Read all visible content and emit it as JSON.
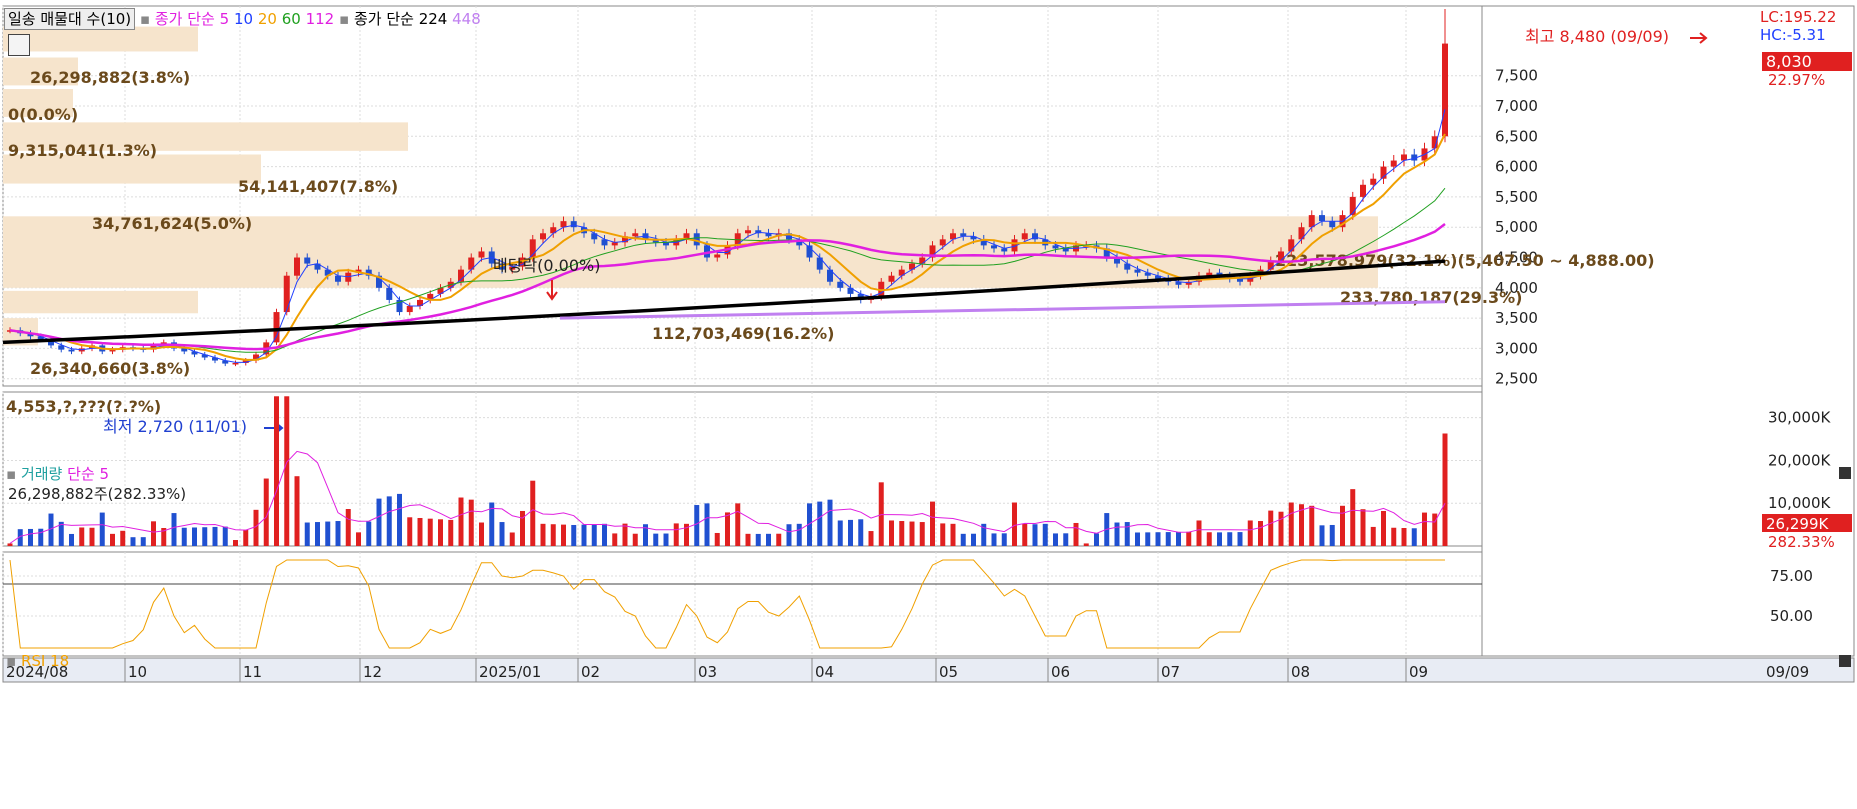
{
  "header": {
    "profile_label": "일송 매물대 수(10)",
    "ma_label": "종가 단순",
    "ma_periods": [
      "5",
      "10",
      "20",
      "60",
      "112"
    ],
    "ma_colors": [
      "#e020e0",
      "#2040ff",
      "#f0a000",
      "#20a020",
      "#e020e0"
    ],
    "long_label": "종가 단순",
    "long_periods": [
      "224",
      "448"
    ],
    "long_colors": [
      "#000000",
      "#c080f0"
    ],
    "lc": "LC:195.22",
    "hc": "HC:-5.31"
  },
  "price_panel": {
    "high_note": "최고 8,480 (09/09)",
    "low_note": "최저 2,720 (11/01)",
    "current_price": "8,030",
    "change_pct": "22.97%",
    "dividend_note": "배당락(0.00%)",
    "yticks": [
      "7,500",
      "7,000",
      "6,500",
      "6,000",
      "5,500",
      "5,000",
      "4,500",
      "4,000",
      "3,500",
      "3,000",
      "2,500"
    ],
    "profile_labels": [
      "26,298,882(3.8%)",
      "0(0.0%)",
      "9,315,041(1.3%)",
      "54,141,407(7.8%)",
      "34,761,624(5.0%)",
      "223,578,979(32.1%)(5,407.50 ~ 4,888.00)",
      "112,703,469(16.2%)",
      "233,780,187(29.3%)",
      "26,340,660(3.8%)",
      "4,553,?,???(?.?%)"
    ]
  },
  "volume_panel": {
    "title_a": "거래량",
    "title_b": "단순 5",
    "info": "26,298,882주(282.33%)",
    "current": "26,299K",
    "pct": "282.33%",
    "yticks": [
      "30,000K",
      "20,000K",
      "10,000K"
    ]
  },
  "rsi_panel": {
    "title": "RSI 18",
    "yticks": [
      "75.00",
      "50.00"
    ]
  },
  "xaxis": {
    "labels": [
      "2024/08",
      "10",
      "11",
      "12",
      "2025/01",
      "02",
      "03",
      "04",
      "05",
      "06",
      "07",
      "08",
      "09"
    ],
    "last_date": "09/09"
  },
  "chart_data": {
    "type": "candlestick",
    "period": "2024/08 - 2025/09/09",
    "price_range": [
      2500,
      8800
    ],
    "series_close": [
      3300,
      3250,
      3200,
      3150,
      3050,
      2980,
      2950,
      3000,
      3050,
      2950,
      2980,
      3020,
      3000,
      2980,
      3050,
      3100,
      3000,
      2950,
      2900,
      2850,
      2800,
      2750,
      2760,
      2800,
      2900,
      3100,
      3600,
      4200,
      4500,
      4400,
      4300,
      4200,
      4100,
      4250,
      4300,
      4200,
      4000,
      3800,
      3600,
      3700,
      3800,
      3900,
      4000,
      4100,
      4300,
      4500,
      4600,
      4400,
      4300,
      4350,
      4500,
      4800,
      4900,
      5000,
      5100,
      5000,
      4900,
      4800,
      4700,
      4750,
      4850,
      4900,
      4800,
      4750,
      4700,
      4800,
      4900,
      4700,
      4500,
      4550,
      4700,
      4900,
      4950,
      4900,
      4850,
      4900,
      4800,
      4700,
      4500,
      4300,
      4100,
      4000,
      3900,
      3800,
      3850,
      4100,
      4200,
      4300,
      4400,
      4500,
      4700,
      4800,
      4900,
      4850,
      4800,
      4700,
      4650,
      4600,
      4800,
      4900,
      4800,
      4700,
      4650,
      4600,
      4700,
      4700,
      4650,
      4500,
      4400,
      4300,
      4250,
      4200,
      4150,
      4100,
      4050,
      4100,
      4200,
      4250,
      4200,
      4150,
      4100,
      4200,
      4300,
      4450,
      4600,
      4800,
      5000,
      5200,
      5100,
      5000,
      5200,
      5500,
      5700,
      5800,
      6000,
      6100,
      6200,
      6100,
      6300,
      6500,
      8030
    ],
    "high": 8480,
    "high_date": "09/09",
    "low": 2720,
    "low_date": "11/01",
    "last_close": 8030,
    "change_pct": 22.97,
    "ma224": [
      3100,
      4440
    ],
    "ma448": [
      3500,
      3770
    ],
    "volume_last": 26298882,
    "rsi_last": 80
  }
}
